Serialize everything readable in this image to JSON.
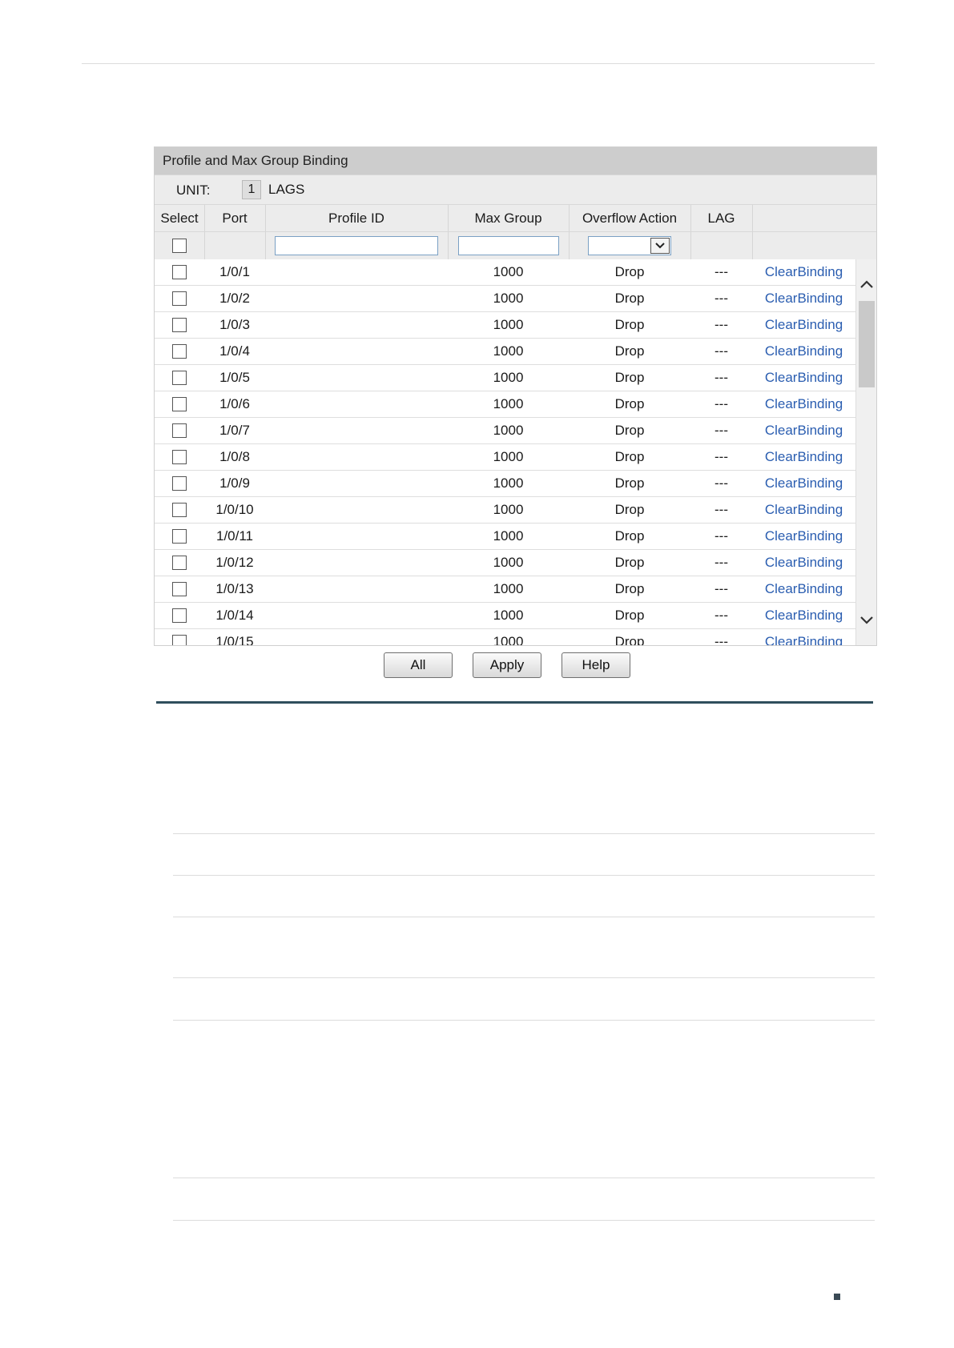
{
  "panel": {
    "title": "Profile and Max Group Binding",
    "unit_label": "UNIT:",
    "unit_value": "1",
    "lags_label": "LAGS"
  },
  "columns": [
    "Select",
    "Port",
    "Profile ID",
    "Max Group",
    "Overflow Action",
    "LAG",
    ""
  ],
  "filter": {
    "profile_id_value": "",
    "max_group_value": "",
    "overflow_action_selected": ""
  },
  "rows": [
    {
      "port": "1/0/1",
      "profile_id": "",
      "max_group": "1000",
      "overflow_action": "Drop",
      "lag": "---",
      "action": "ClearBinding"
    },
    {
      "port": "1/0/2",
      "profile_id": "",
      "max_group": "1000",
      "overflow_action": "Drop",
      "lag": "---",
      "action": "ClearBinding"
    },
    {
      "port": "1/0/3",
      "profile_id": "",
      "max_group": "1000",
      "overflow_action": "Drop",
      "lag": "---",
      "action": "ClearBinding"
    },
    {
      "port": "1/0/4",
      "profile_id": "",
      "max_group": "1000",
      "overflow_action": "Drop",
      "lag": "---",
      "action": "ClearBinding"
    },
    {
      "port": "1/0/5",
      "profile_id": "",
      "max_group": "1000",
      "overflow_action": "Drop",
      "lag": "---",
      "action": "ClearBinding"
    },
    {
      "port": "1/0/6",
      "profile_id": "",
      "max_group": "1000",
      "overflow_action": "Drop",
      "lag": "---",
      "action": "ClearBinding"
    },
    {
      "port": "1/0/7",
      "profile_id": "",
      "max_group": "1000",
      "overflow_action": "Drop",
      "lag": "---",
      "action": "ClearBinding"
    },
    {
      "port": "1/0/8",
      "profile_id": "",
      "max_group": "1000",
      "overflow_action": "Drop",
      "lag": "---",
      "action": "ClearBinding"
    },
    {
      "port": "1/0/9",
      "profile_id": "",
      "max_group": "1000",
      "overflow_action": "Drop",
      "lag": "---",
      "action": "ClearBinding"
    },
    {
      "port": "1/0/10",
      "profile_id": "",
      "max_group": "1000",
      "overflow_action": "Drop",
      "lag": "---",
      "action": "ClearBinding"
    },
    {
      "port": "1/0/11",
      "profile_id": "",
      "max_group": "1000",
      "overflow_action": "Drop",
      "lag": "---",
      "action": "ClearBinding"
    },
    {
      "port": "1/0/12",
      "profile_id": "",
      "max_group": "1000",
      "overflow_action": "Drop",
      "lag": "---",
      "action": "ClearBinding"
    },
    {
      "port": "1/0/13",
      "profile_id": "",
      "max_group": "1000",
      "overflow_action": "Drop",
      "lag": "---",
      "action": "ClearBinding"
    },
    {
      "port": "1/0/14",
      "profile_id": "",
      "max_group": "1000",
      "overflow_action": "Drop",
      "lag": "---",
      "action": "ClearBinding"
    },
    {
      "port": "1/0/15",
      "profile_id": "",
      "max_group": "1000",
      "overflow_action": "Drop",
      "lag": "---",
      "action": "ClearBinding"
    }
  ],
  "buttons": {
    "all": "All",
    "apply": "Apply",
    "help": "Help"
  },
  "colors": {
    "link": "#2a5db0",
    "title_bar": "#cdcdcd",
    "header_bg": "#ececec",
    "section_rule": "#2f4e5c"
  }
}
